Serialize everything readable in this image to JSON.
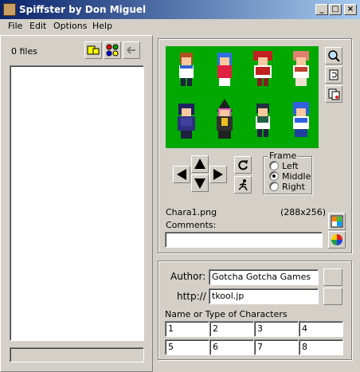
{
  "window": {
    "title": "Spiffster by Don Miguel",
    "controls": [
      "minimize-icon",
      "maximize-icon",
      "close-icon"
    ]
  },
  "menu": {
    "items": [
      "File",
      "Edit",
      "Options",
      "Help"
    ]
  },
  "left_panel": {
    "file_count": "0 files",
    "tools": [
      "open-folder-icon",
      "palette-icon",
      "back-icon"
    ],
    "status": ""
  },
  "preview": {
    "tools": [
      "zoom-icon",
      "refresh-icon",
      "copy-icon"
    ],
    "frame": {
      "legend": "Frame",
      "options": [
        "Left",
        "Middle",
        "Right"
      ],
      "selected": "Middle"
    },
    "filename": "Chara1.png",
    "dimensions": "(288x256)",
    "comments_label": "Comments:",
    "comments_value": ""
  },
  "info": {
    "author_label": "Author:",
    "author_value": "Gotcha Gotcha Games",
    "url_label": "http://",
    "url_value": "tkool.jp",
    "characters_label": "Name or Type of Characters",
    "characters": [
      "1",
      "2",
      "3",
      "4",
      "5",
      "6",
      "7",
      "8"
    ]
  },
  "colors": {
    "title_start": "#0a246a",
    "title_end": "#a6caf0",
    "sprite_bg": "#00a800",
    "face": "#d4d0c8"
  }
}
